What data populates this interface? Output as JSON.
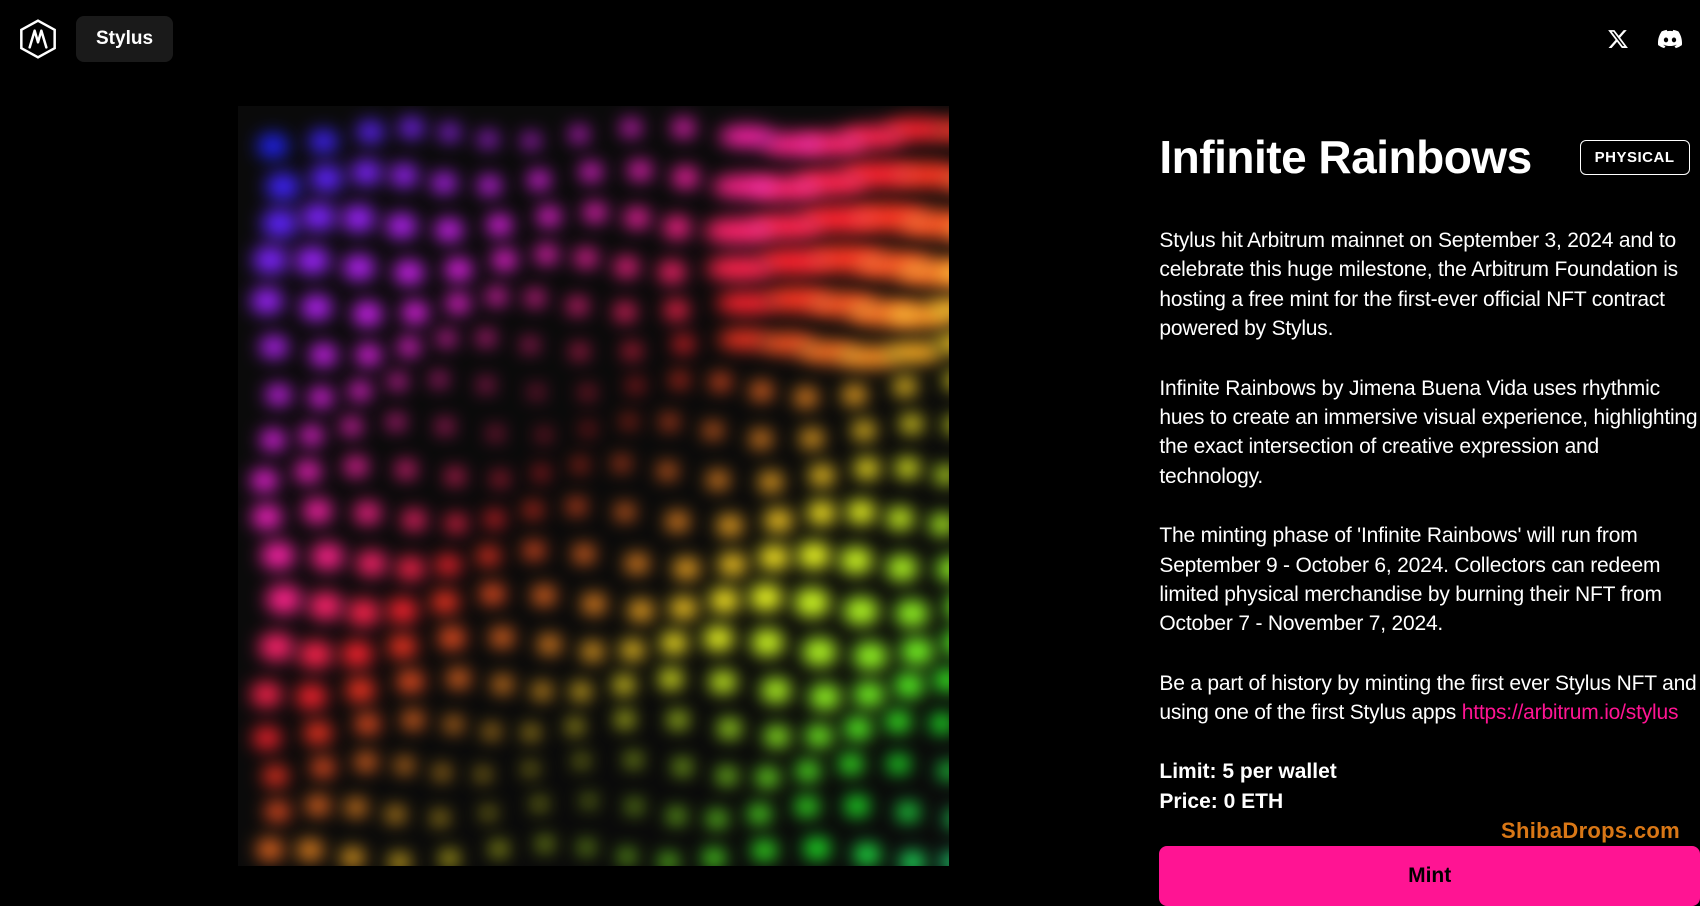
{
  "nav": {
    "stylus_label": "Stylus"
  },
  "project": {
    "title": "Infinite Rainbows",
    "badge": "PHYSICAL",
    "paragraphs": [
      "Stylus hit Arbitrum mainnet on September 3, 2024 and to celebrate this huge milestone, the Arbitrum Foundation is hosting a free mint for the first-ever official NFT contract powered by Stylus.",
      "Infinite Rainbows by Jimena Buena Vida uses rhythmic hues to create an immersive visual experience, highlighting the exact intersection of creative expression and technology.",
      "The minting phase of 'Infinite Rainbows' will run from September 9 - October 6, 2024. Collectors can redeem limited physical merchandise by burning their NFT from October 7 - November 7, 2024."
    ],
    "cta_text": "Be a part of history by minting the first ever Stylus NFT and using one of the first Stylus apps ",
    "cta_link_text": "https://arbitrum.io/stylus",
    "limit_label": "Limit:",
    "limit_value": "5 per wallet",
    "price_label": "Price:",
    "price_value": "0 ETH",
    "mint_label": "Mint"
  },
  "watermark": "ShibaDrops.com"
}
